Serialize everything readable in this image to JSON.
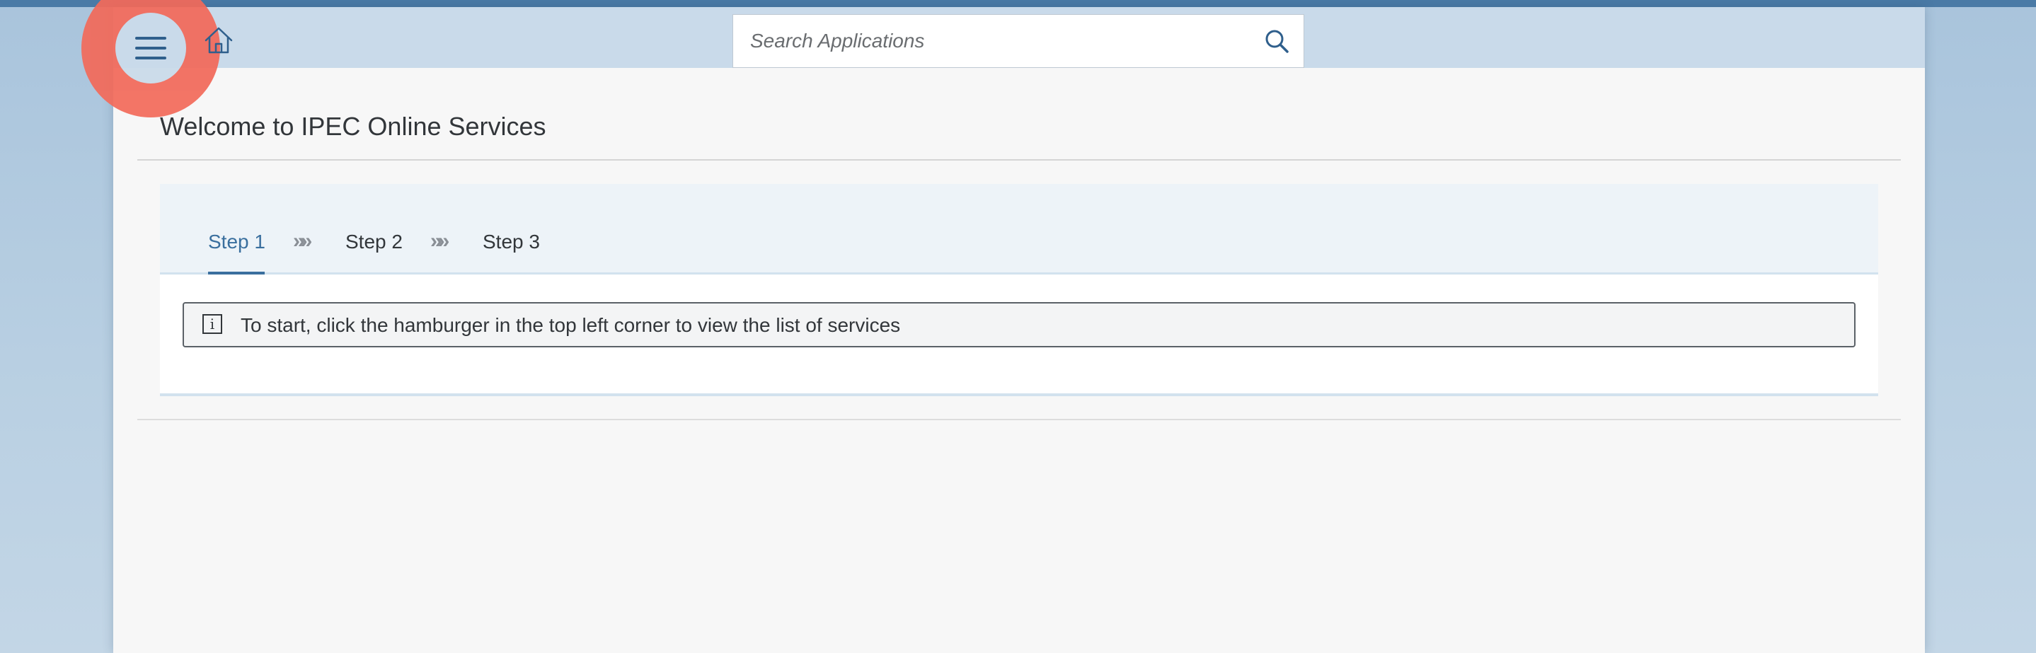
{
  "header": {
    "menu_icon": "hamburger-menu-icon",
    "home_icon": "home-icon",
    "search": {
      "placeholder": "Search Applications",
      "icon": "search-icon"
    }
  },
  "page": {
    "title": "Welcome to IPEC Online Services"
  },
  "wizard": {
    "steps": [
      {
        "label": "Step 1",
        "active": true
      },
      {
        "label": "Step 2",
        "active": false
      },
      {
        "label": "Step 3",
        "active": false
      }
    ],
    "separator": "»»",
    "info_message": "To start, click the hamburger in the top left corner to view the list of services",
    "info_icon": "info-icon"
  },
  "colors": {
    "accent": "#3a6f9e",
    "highlight": "#f26a5a",
    "header_bg": "#c9daea"
  }
}
